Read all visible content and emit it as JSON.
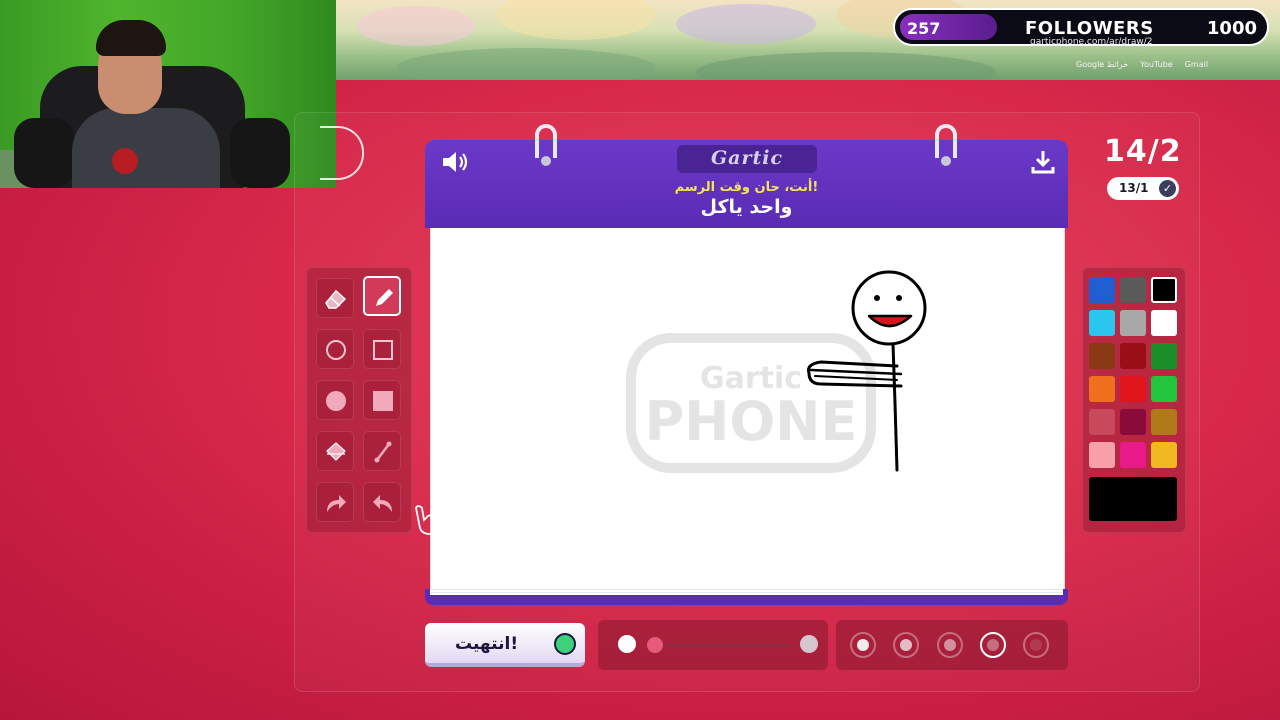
{
  "overlay": {
    "followers_count": "257",
    "followers_label": "FOLLOWERS",
    "followers_goal": "1000",
    "followers_progress": 0.257,
    "browser_url": "garticphone.com/ar/draw/2",
    "bookmarks": [
      "Google خرائط",
      "YouTube",
      "Gmail"
    ]
  },
  "game": {
    "round": "14/2",
    "sub_round": "13/1",
    "brand": "Gartic",
    "hint": "أنت، حان وقت الرسم!",
    "word": "واحد ياكل",
    "done_label": "انتهيت!"
  },
  "colors": {
    "accent_purple": "#5a2bb3",
    "background_red": "#d8294a",
    "selected_color": "#000000",
    "palette": [
      "#1f5fd1",
      "#5a5a5a",
      "#000000",
      "#2bc6f0",
      "#a8a8a8",
      "#ffffff",
      "#8a3a12",
      "#9a0f16",
      "#1b8f2a",
      "#f07020",
      "#e0141b",
      "#23c53c",
      "#c84a5a",
      "#8a0a3a",
      "#b07a1a",
      "#f7a0a8",
      "#e81a8a",
      "#f2b81f"
    ]
  },
  "icons": {
    "sound": "speaker-icon",
    "download": "download-icon",
    "done": "check-icon"
  },
  "tools": [
    "eraser",
    "pencil",
    "ellipse-outline",
    "rect-outline",
    "ellipse-filled",
    "rect-filled",
    "fill-bucket",
    "line",
    "redo",
    "undo"
  ]
}
